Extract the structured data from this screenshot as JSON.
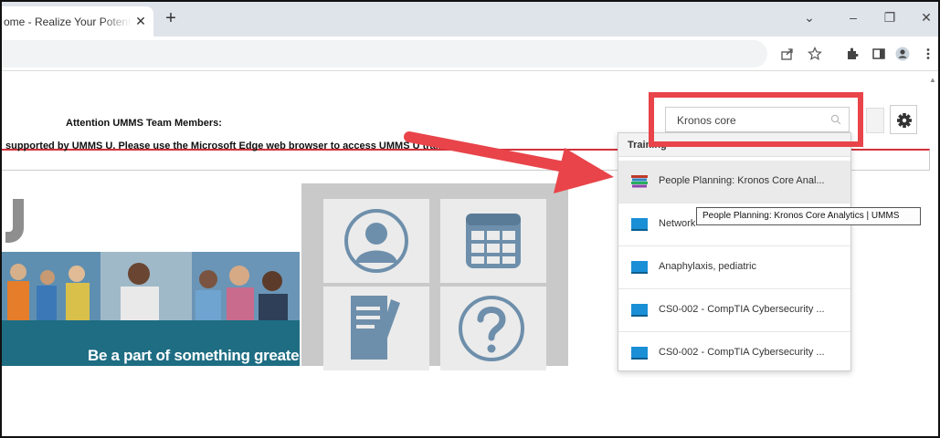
{
  "browser": {
    "tab_title": "ome - Realize Your Potential",
    "tab_close": "✕",
    "new_tab": "+",
    "window_controls": {
      "menu": "⌄",
      "minimize": "–",
      "restore": "❐",
      "close": "✕"
    },
    "toolbar_icons": [
      "share-icon",
      "bookmark-star-icon",
      "extensions-icon",
      "sidepanel-icon",
      "profile-icon",
      "menu-kebab-icon"
    ]
  },
  "header": {
    "search": {
      "value": "Kronos core"
    }
  },
  "notice": {
    "heading": "Attention UMMS Team Members:",
    "body": "supported by UMMS U. Please use the Microsoft Edge web browser to access UMMS U training."
  },
  "banner": {
    "caption": "Be a part of something greater."
  },
  "tiles": [
    "profile-icon",
    "calendar-icon",
    "document-edit-icon",
    "help-question-icon"
  ],
  "dropdown": {
    "section_label": "Training",
    "items": [
      {
        "label": "People Planning: Kronos Core Anal...",
        "icon": "books-icon"
      },
      {
        "label": "Network",
        "icon": "course-screen-icon"
      },
      {
        "label": "Anaphylaxis, pediatric",
        "icon": "course-screen-icon"
      },
      {
        "label": "CS0-002 - CompTIA Cybersecurity ...",
        "icon": "course-screen-icon"
      },
      {
        "label": "CS0-002 - CompTIA Cybersecurity ...",
        "icon": "course-screen-icon"
      }
    ]
  },
  "tooltip": "People Planning:  Kronos Core Analytics | UMMS",
  "colors": {
    "annotation_red": "#e8444a",
    "site_accent_red": "#d2323c",
    "banner_teal": "#1e6d83",
    "course_icon_blue": "#1a8fd6"
  }
}
